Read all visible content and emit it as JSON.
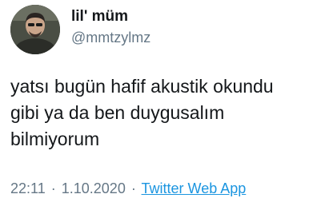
{
  "author": {
    "display_name": "lil' müm",
    "handle": "@mmtzylmz",
    "avatar_icon": "profile-photo"
  },
  "tweet": {
    "lines": [
      "yatsı bugün hafif akustik okundu",
      "gibi ya da ben duygusalım",
      "bilmiyorum"
    ]
  },
  "meta": {
    "time": "22:11",
    "separator": "·",
    "date": "1.10.2020",
    "source": "Twitter Web App"
  },
  "colors": {
    "text": "#14171a",
    "secondary": "#657786",
    "link": "#1b95e0"
  }
}
